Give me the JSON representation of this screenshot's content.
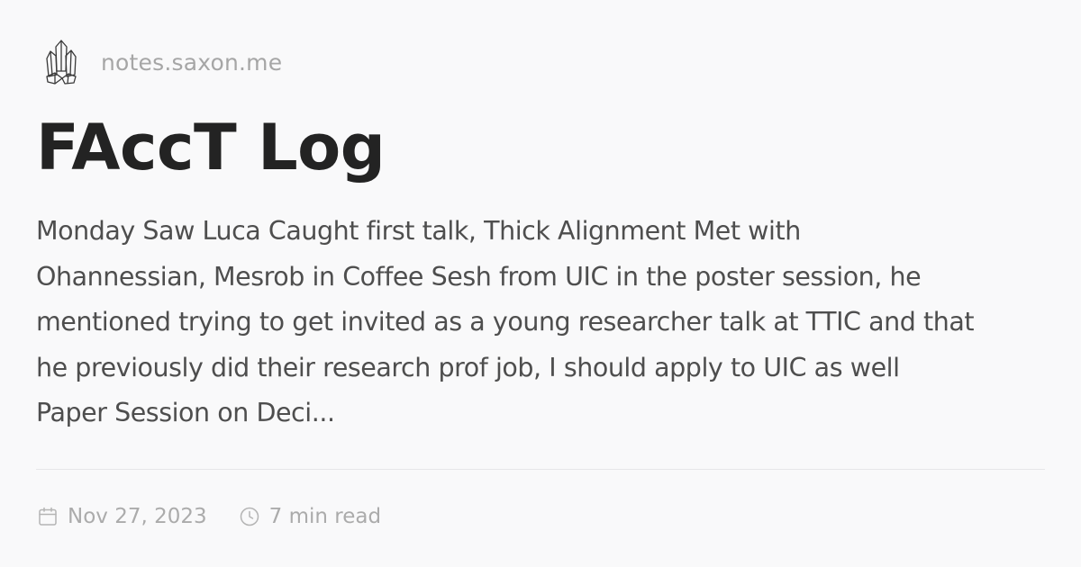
{
  "site": {
    "name": "notes.saxon.me",
    "logo_icon": "crystal-cluster-icon"
  },
  "post": {
    "title": "FAccT Log",
    "excerpt_lines": [
      "Monday Saw Luca Caught first talk, Thick Alignment Met with",
      "Ohannessian, Mesrob in Coffee Sesh from UIC in the poster session, he",
      "mentioned trying to get invited as a young researcher talk at TTIC and that",
      "he previously did their research prof job, I should apply to UIC as well",
      "Paper Session on Deci..."
    ]
  },
  "meta": {
    "date": "Nov 27, 2023",
    "date_icon": "calendar-icon",
    "read_time": "7 min read",
    "read_time_icon": "clock-icon"
  },
  "colors": {
    "background": "#f9f9fa",
    "title": "#232323",
    "body_text": "#4e4e4e",
    "muted_text": "#a6a6a6",
    "divider": "#e6e6e8"
  }
}
